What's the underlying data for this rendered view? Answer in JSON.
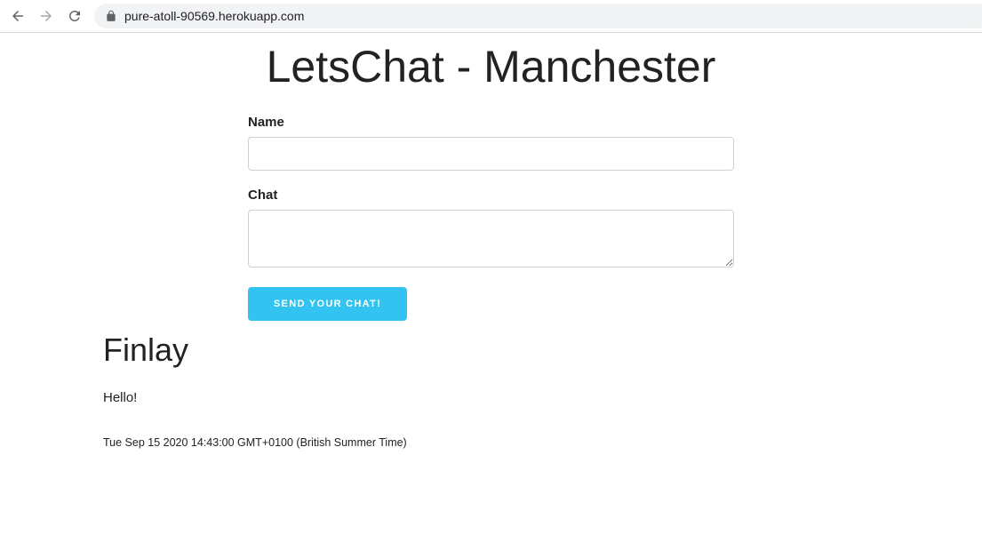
{
  "browser": {
    "url": "pure-atoll-90569.herokuapp.com",
    "icons": [
      "back-arrow-icon",
      "forward-arrow-icon",
      "reload-icon",
      "lock-icon"
    ]
  },
  "page": {
    "title": "LetsChat - Manchester"
  },
  "form": {
    "name_label": "Name",
    "name_value": "",
    "chat_label": "Chat",
    "chat_value": "",
    "send_label": "Send your chat!",
    "send_color": "#33c3f0"
  },
  "messages": [
    {
      "name": "Finlay",
      "text": "Hello!",
      "timestamp": "Tue Sep 15 2020 14:43:00 GMT+0100 (British Summer Time)"
    }
  ]
}
